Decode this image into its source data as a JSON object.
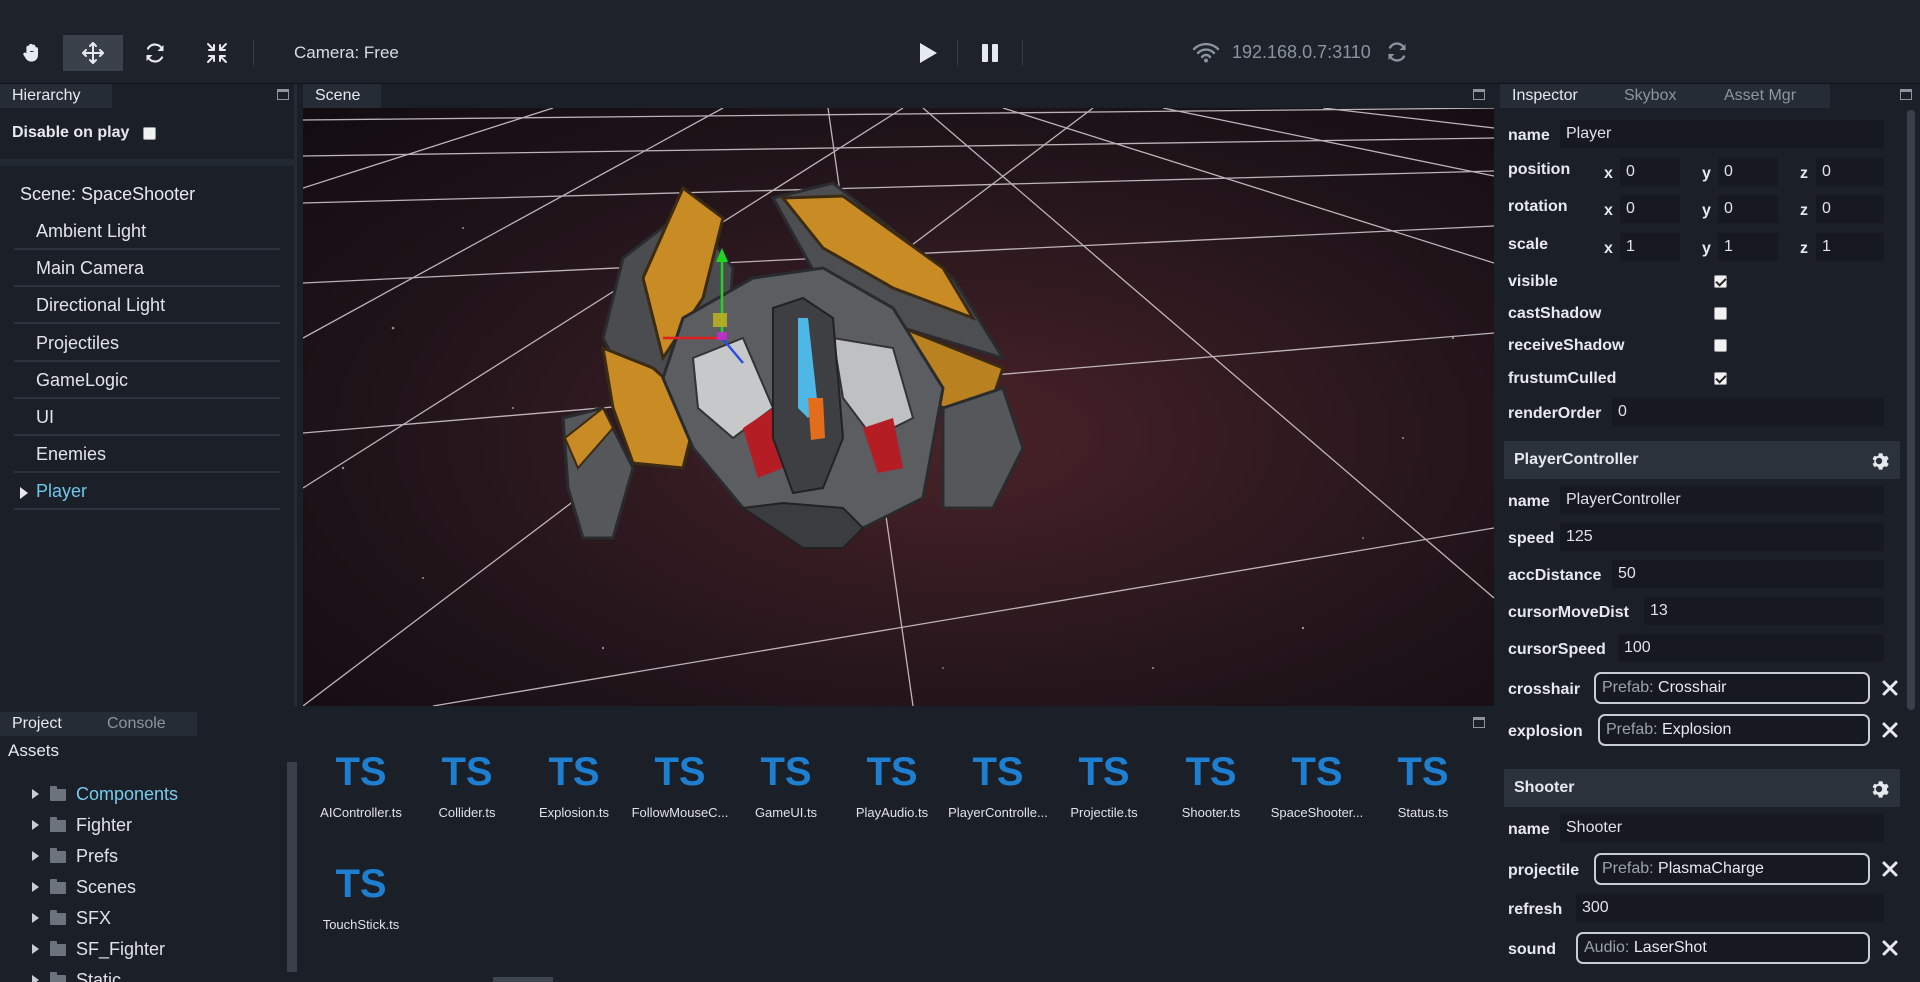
{
  "toolbar": {
    "tools": [
      {
        "name": "hand-tool",
        "icon": "hand-icon"
      },
      {
        "name": "move-tool",
        "icon": "move-arrows-icon"
      },
      {
        "name": "rotate-tool",
        "icon": "rotate-icon"
      },
      {
        "name": "scale-tool",
        "icon": "compress-icon"
      }
    ],
    "camera_label": "Camera: Free",
    "play_icon": "play-icon",
    "pause_icon": "pause-icon",
    "server_address": "192.168.0.7:3110",
    "wifi_icon": "wifi-icon",
    "refresh_icon": "refresh-icon"
  },
  "hierarchy": {
    "tab": "Hierarchy",
    "disable_on_play": "Disable on play",
    "disable_checked": false,
    "scene_label": "Scene: SpaceShooter",
    "items": [
      {
        "label": "Ambient Light"
      },
      {
        "label": "Main Camera"
      },
      {
        "label": "Directional Light"
      },
      {
        "label": "Projectiles"
      },
      {
        "label": "GameLogic"
      },
      {
        "label": "UI"
      },
      {
        "label": "Enemies"
      },
      {
        "label": "Player"
      }
    ]
  },
  "scene": {
    "tab": "Scene"
  },
  "project": {
    "tabs": [
      "Project",
      "Console"
    ],
    "assets_title": "Assets",
    "folders": [
      {
        "label": "Components"
      },
      {
        "label": "Fighter"
      },
      {
        "label": "Prefs"
      },
      {
        "label": "Scenes"
      },
      {
        "label": "SFX"
      },
      {
        "label": "SF_Fighter"
      },
      {
        "label": "Static"
      }
    ],
    "file_icon_text": "TS",
    "files": [
      {
        "name": "AIController.ts"
      },
      {
        "name": "Collider.ts"
      },
      {
        "name": "Explosion.ts"
      },
      {
        "name": "FollowMouseC..."
      },
      {
        "name": "GameUI.ts"
      },
      {
        "name": "PlayAudio.ts"
      },
      {
        "name": "PlayerControlle..."
      },
      {
        "name": "Projectile.ts"
      },
      {
        "name": "Shooter.ts"
      },
      {
        "name": "SpaceShooter..."
      },
      {
        "name": "Status.ts"
      },
      {
        "name": "TouchStick.ts"
      }
    ]
  },
  "inspector": {
    "tabs": [
      "Inspector",
      "Skybox",
      "Asset Mgr"
    ],
    "object": {
      "name_label": "name",
      "name_value": "Player",
      "position_label": "position",
      "rotation_label": "rotation",
      "scale_label": "scale",
      "x": "x",
      "y": "y",
      "z": "z",
      "position": [
        "0",
        "0",
        "0"
      ],
      "rotation": [
        "0",
        "0",
        "0"
      ],
      "scale": [
        "1",
        "1",
        "1"
      ],
      "visible_label": "visible",
      "visible": true,
      "castShadow_label": "castShadow",
      "castShadow": false,
      "receiveShadow_label": "receiveShadow",
      "receiveShadow": false,
      "frustumCulled_label": "frustumCulled",
      "frustumCulled": true,
      "renderOrder_label": "renderOrder",
      "renderOrder": "0"
    },
    "player_controller": {
      "title": "PlayerController",
      "name_label": "name",
      "name_value": "PlayerController",
      "speed_label": "speed",
      "speed": "125",
      "accDistance_label": "accDistance",
      "accDistance": "50",
      "cursorMoveDist_label": "cursorMoveDist",
      "cursorMoveDist": "13",
      "cursorSpeed_label": "cursorSpeed",
      "cursorSpeed": "100",
      "crosshair_label": "crosshair",
      "crosshair_type": "Prefab:",
      "crosshair_value": "Crosshair",
      "explosion_label": "explosion",
      "explosion_type": "Prefab:",
      "explosion_value": "Explosion"
    },
    "shooter": {
      "title": "Shooter",
      "name_label": "name",
      "name_value": "Shooter",
      "projectile_label": "projectile",
      "projectile_type": "Prefab:",
      "projectile_value": "PlasmaCharge",
      "refresh_label": "refresh",
      "refresh": "300",
      "sound_label": "sound",
      "sound_type": "Audio:",
      "sound_value": "LaserShot"
    }
  },
  "colors": {
    "accent_selected": "#6ec6ee",
    "ts_blue": "#1e7fd0",
    "background": "#1b2028"
  }
}
